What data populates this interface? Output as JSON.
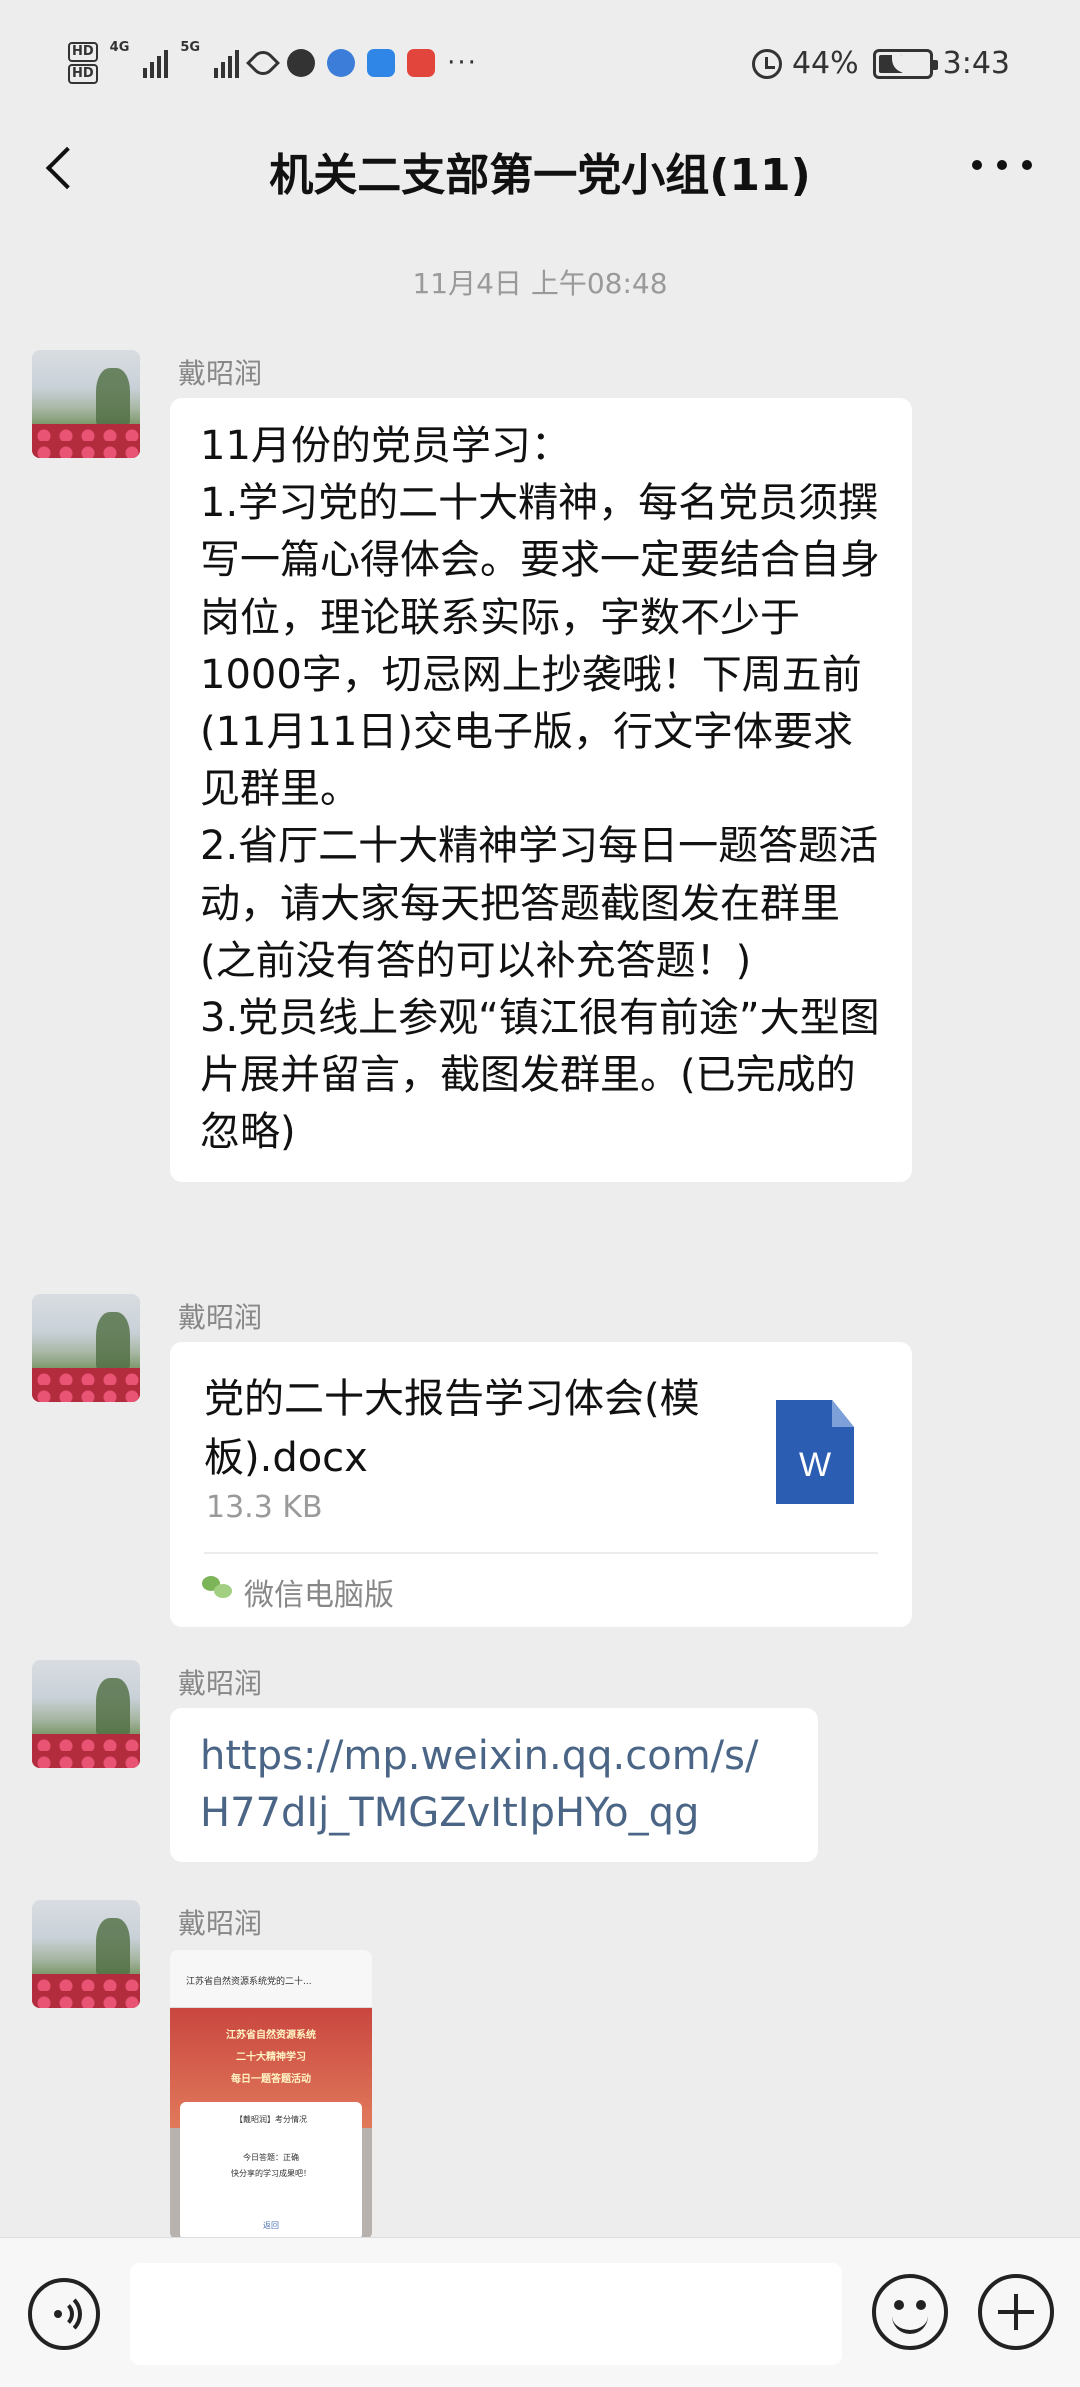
{
  "status_bar": {
    "hd1": "HD",
    "hd2": "HD",
    "sim1_label": "4G",
    "sim2_label": "5G",
    "battery_percent": "44%",
    "battery_level": 0.44,
    "time": "3:43",
    "more_dots": "···"
  },
  "header": {
    "title": "机关二支部第一党小组(11)"
  },
  "chat": {
    "timestamp": "11月4日 上午08:48",
    "messages": [
      {
        "sender": "戴昭润",
        "type": "text",
        "text": "11月份的党员学习：\n1.学习党的二十大精神，每名党员须撰写一篇心得体会。要求一定要结合自身岗位，理论联系实际，字数不少于1000字，切忌网上抄袭哦！下周五前(11月11日)交电子版，行文字体要求见群里。\n2.省厅二十大精神学习每日一题答题活动，请大家每天把答题截图发在群里(之前没有答的可以补充答题！)\n3.党员线上参观“镇江很有前途”大型图片展并留言，截图发群里。(已完成的忽略)"
      },
      {
        "sender": "戴昭润",
        "type": "file",
        "file_name": "党的二十大报告学习体会(模板).docx",
        "file_size": "13.3 KB",
        "file_icon": "word-document-icon",
        "file_icon_letter": "W",
        "source": "微信电脑版",
        "source_icon": "wechat-icon"
      },
      {
        "sender": "戴昭润",
        "type": "link",
        "url": "https://mp.weixin.qq.com/s/H77dIj_TMGZvItIpHYo_qg"
      },
      {
        "sender": "戴昭润",
        "type": "image",
        "thumb_title": "江苏省自然资源系统党的二十...",
        "thumb_banner_1": "江苏省自然资源系统",
        "thumb_banner_2": "二十大精神学习",
        "thumb_banner_3": "每日一题答题活动",
        "thumb_dialog_1": "【戴昭润】考分情况",
        "thumb_dialog_2": "今日答题：正确",
        "thumb_dialog_3": "快分享的学习成果吧！",
        "thumb_dialog_4": "返回"
      }
    ]
  },
  "input_bar": {
    "voice_icon": "voice-icon",
    "emoji_icon": "emoji-icon",
    "plus_icon": "plus-icon"
  },
  "colors": {
    "background": "#ededed",
    "bubble": "#ffffff",
    "link": "#4a6585",
    "word_blue": "#2b5eb3"
  }
}
